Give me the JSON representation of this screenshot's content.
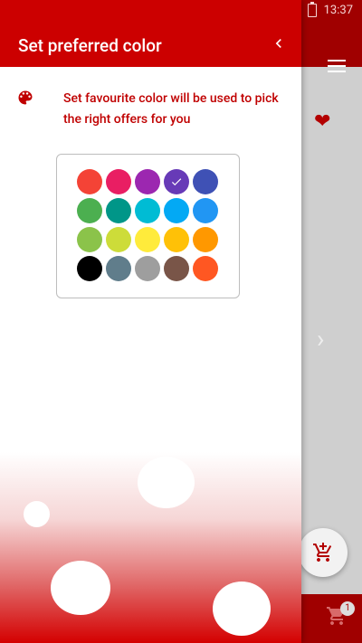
{
  "status_bar": {
    "time": "13:37"
  },
  "drawer": {
    "title": "Set preferred color",
    "intro_text": "Set favourite color will be used to pick the right offers for you",
    "icons": {
      "back": "chevron-left-icon",
      "palette": "palette-icon"
    },
    "colors": [
      {
        "hex": "#F44336",
        "selected": false
      },
      {
        "hex": "#E91E63",
        "selected": false
      },
      {
        "hex": "#9C27B0",
        "selected": false
      },
      {
        "hex": "#673AB7",
        "selected": true
      },
      {
        "hex": "#3F51B5",
        "selected": false
      },
      {
        "hex": "#4CAF50",
        "selected": false
      },
      {
        "hex": "#009688",
        "selected": false
      },
      {
        "hex": "#00BCD4",
        "selected": false
      },
      {
        "hex": "#03A9F4",
        "selected": false
      },
      {
        "hex": "#2196F3",
        "selected": false
      },
      {
        "hex": "#8BC34A",
        "selected": false
      },
      {
        "hex": "#CDDC39",
        "selected": false
      },
      {
        "hex": "#FFEB3B",
        "selected": false
      },
      {
        "hex": "#FFC107",
        "selected": false
      },
      {
        "hex": "#FF9800",
        "selected": false
      },
      {
        "hex": "#000000",
        "selected": false
      },
      {
        "hex": "#607D8B",
        "selected": false
      },
      {
        "hex": "#9E9E9E",
        "selected": false
      },
      {
        "hex": "#795548",
        "selected": false
      },
      {
        "hex": "#FF5722",
        "selected": false
      }
    ],
    "accent": "#CC0000"
  },
  "background_app": {
    "cart_badge": "1",
    "icons": {
      "menu": "menu-icon",
      "favorite": "heart-icon",
      "next": "chevron-right-icon",
      "add_to_cart": "add-shopping-cart-icon",
      "cart": "shopping-cart-icon"
    }
  }
}
